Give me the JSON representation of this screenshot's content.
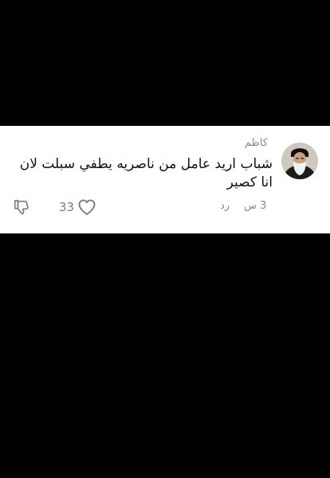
{
  "comment": {
    "author": "كاظم",
    "text": "شباب اريد عامل من ناصريه يطفي سبلت لان انا كصير",
    "timestamp": "3 س",
    "reply_label": "رد",
    "like_count": "33"
  },
  "icons": {
    "like": "heart-outline-icon",
    "dislike": "thumbs-down-icon",
    "avatar": "profile-avatar"
  },
  "colors": {
    "background": "#000000",
    "card": "#ffffff",
    "text": "#111111",
    "muted": "#8a8a8a"
  }
}
